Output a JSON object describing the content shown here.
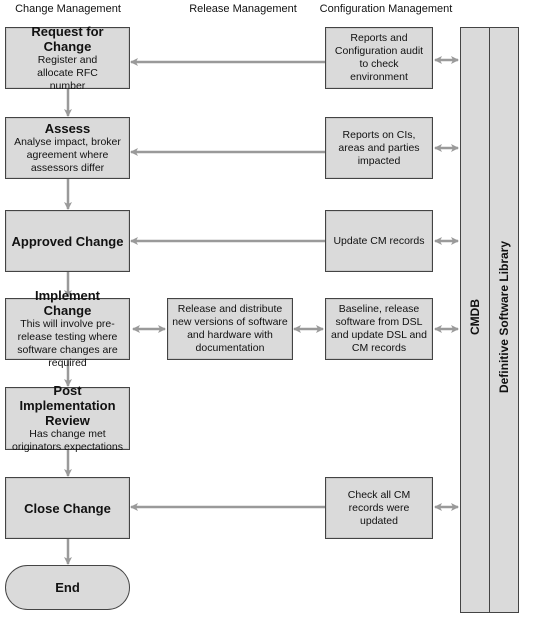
{
  "headers": {
    "change": "Change Management",
    "release": "Release Management",
    "config": "Configuration Management"
  },
  "change_steps": [
    {
      "title": "Request for Change",
      "desc": "Register and allocate RFC number"
    },
    {
      "title": "Assess",
      "desc": "Analyse impact, broker agreement where assessors differ"
    },
    {
      "title": "Approved Change",
      "desc": ""
    },
    {
      "title": "Implement Change",
      "desc": "This will involve pre-release testing where software changes are required"
    },
    {
      "title": "Post Implementation Review",
      "desc": "Has change met originators expectations"
    },
    {
      "title": "Close Change",
      "desc": ""
    }
  ],
  "end_label": "End",
  "release_box": "Release and distribute new versions of software and hardware with documentation",
  "config_boxes": [
    "Reports and Configuration audit to check environment",
    "Reports on CIs, areas and parties impacted",
    "Update CM records",
    "Baseline, release software from DSL and update DSL and CM records",
    "Check all CM records were updated"
  ],
  "lanes": {
    "cmdb": "CMDB",
    "dsl": "Definitive Software Library"
  },
  "colors": {
    "box_fill": "#dadada",
    "arrow": "#9a9a9a",
    "border": "#444444"
  }
}
